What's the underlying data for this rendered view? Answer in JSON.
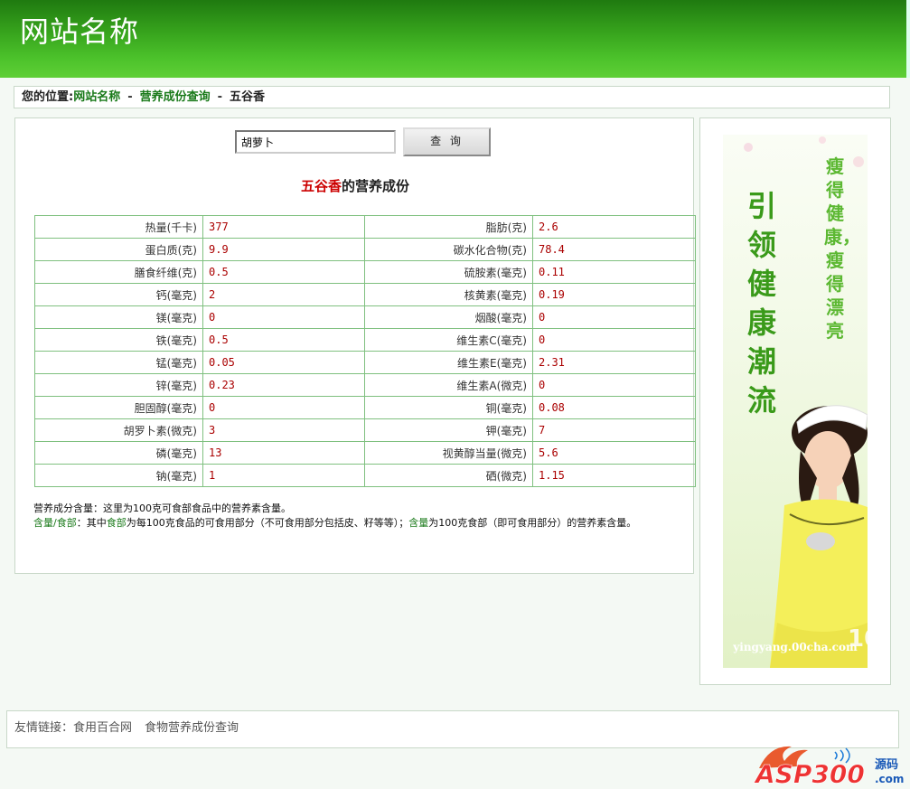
{
  "header": {
    "site_title": "网站名称"
  },
  "breadcrumb": {
    "prefix": "您的位置:",
    "items": [
      "网站名称",
      "营养成份查询"
    ],
    "current": "五谷香",
    "separator": "-"
  },
  "search": {
    "value": "胡萝卜",
    "button_label": "查 询"
  },
  "result": {
    "food_name": "五谷香",
    "title_suffix": "的营养成份"
  },
  "nutrition_rows": [
    {
      "l1": "热量(千卡)",
      "v1": "377",
      "l2": "脂肪(克)",
      "v2": "2.6"
    },
    {
      "l1": "蛋白质(克)",
      "v1": "9.9",
      "l2": "碳水化合物(克)",
      "v2": "78.4"
    },
    {
      "l1": "膳食纤维(克)",
      "v1": "0.5",
      "l2": "硫胺素(毫克)",
      "v2": "0.11"
    },
    {
      "l1": "钙(毫克)",
      "v1": "2",
      "l2": "核黄素(毫克)",
      "v2": "0.19"
    },
    {
      "l1": "镁(毫克)",
      "v1": "0",
      "l2": "烟酸(毫克)",
      "v2": "0"
    },
    {
      "l1": "铁(毫克)",
      "v1": "0.5",
      "l2": "维生素C(毫克)",
      "v2": "0"
    },
    {
      "l1": "锰(毫克)",
      "v1": "0.05",
      "l2": "维生素E(毫克)",
      "v2": "2.31"
    },
    {
      "l1": "锌(毫克)",
      "v1": "0.23",
      "l2": "维生素A(微克)",
      "v2": "0"
    },
    {
      "l1": "胆固醇(毫克)",
      "v1": "0",
      "l2": "铜(毫克)",
      "v2": "0.08"
    },
    {
      "l1": "胡罗卜素(微克)",
      "v1": "3",
      "l2": "钾(毫克)",
      "v2": "7"
    },
    {
      "l1": "磷(毫克)",
      "v1": "13",
      "l2": "视黄醇当量(微克)",
      "v2": "5.6"
    },
    {
      "l1": "钠(毫克)",
      "v1": "1",
      "l2": "硒(微克)",
      "v2": "1.15"
    }
  ],
  "notes": {
    "line1": "营养成分含量：这里为100克可食部食品中的营养素含量。",
    "term1": "含量/食部",
    "text1": "：其中",
    "term2": "食部",
    "text2": "为每100克食品的可食用部分（不可食用部分包括皮、籽等等）；",
    "term3": "含量",
    "text3": "为100克食部（即可食用部分）的营养素含量。"
  },
  "ad": {
    "slogan_main": "引领健康潮流",
    "slogan_sub": "瘦得健康，瘦得漂亮",
    "url": "yingyang.00cha.com"
  },
  "footer": {
    "label": "友情链接：",
    "links": [
      "食用百合网",
      "食物营养成份查询"
    ]
  },
  "watermark": {
    "brand": "ASP300",
    "tag": "源码",
    "domain": ".com"
  },
  "colors": {
    "header_green": "#36a21c",
    "link_green": "#1a7a1a",
    "table_border": "#7fc07f",
    "value_red": "#aa0000"
  }
}
